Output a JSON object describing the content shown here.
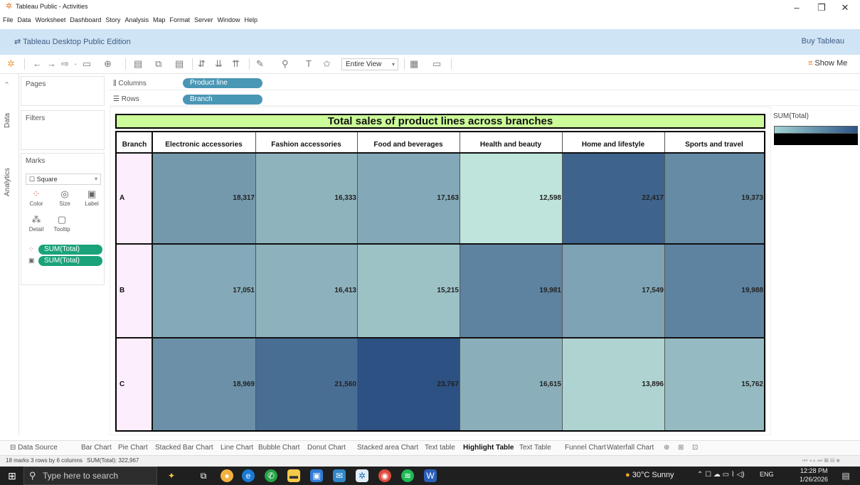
{
  "window": {
    "title": "Tableau Public - Activities"
  },
  "menu": [
    "File",
    "Data",
    "Worksheet",
    "Dashboard",
    "Story",
    "Analysis",
    "Map",
    "Format",
    "Server",
    "Window",
    "Help"
  ],
  "edition": {
    "label": "Tableau Desktop Public Edition",
    "buy": "Buy Tableau"
  },
  "toolbar": {
    "fit": "Entire View",
    "show_me": "Show Me"
  },
  "sidetabs": {
    "data": "Data",
    "analytics": "Analytics"
  },
  "panes": {
    "pages": "Pages",
    "filters": "Filters",
    "marks": "Marks",
    "mark_type": "Square",
    "buttons": {
      "color": "Color",
      "size": "Size",
      "label": "Label",
      "detail": "Detail",
      "tooltip": "Tooltip"
    },
    "pills": [
      "SUM(Total)",
      "SUM(Total)"
    ]
  },
  "shelves": {
    "columns": {
      "label": "Columns",
      "pill": "Product line"
    },
    "rows": {
      "label": "Rows",
      "pill": "Branch"
    }
  },
  "legend": {
    "title": "SUM(Total)",
    "colors": [
      "#9fd3d3",
      "#2d5486"
    ]
  },
  "chart_data": {
    "type": "heatmap",
    "title": "Total sales of product lines across branches",
    "row_header": "Branch",
    "columns": [
      "Electronic accessories",
      "Fashion accessories",
      "Food and beverages",
      "Health and beauty",
      "Home and lifestyle",
      "Sports and travel"
    ],
    "rows": [
      "A",
      "B",
      "C"
    ],
    "values": [
      [
        18317,
        16333,
        17163,
        12598,
        22417,
        19373
      ],
      [
        17051,
        16413,
        15215,
        19981,
        17549,
        19988
      ],
      [
        18969,
        21560,
        23767,
        16615,
        13896,
        15762
      ]
    ],
    "labels": [
      [
        "18,317",
        "16,333",
        "17,163",
        "12,598",
        "22,417",
        "19,373"
      ],
      [
        "17,051",
        "16,413",
        "15,215",
        "19,981",
        "17,549",
        "19,988"
      ],
      [
        "18,969",
        "21,560",
        "23,767",
        "16,615",
        "13,896",
        "15,762"
      ]
    ],
    "color_range": [
      "#bfe4db",
      "#2c5182"
    ]
  },
  "sheet_tabs": {
    "data_source": "Data Source",
    "tabs": [
      "Bar Chart",
      "Pie Chart",
      "Stacked Bar Chart",
      "Line Chart",
      "Bubble Chart",
      "Donut Chart",
      "Stacked area Chart",
      "Text table",
      "Highlight Table",
      "Text Table",
      "Funnel Chart",
      "Waterfall Chart"
    ],
    "active": "Highlight Table"
  },
  "status": {
    "marks": "18 marks",
    "dims": "3 rows by 6 columns",
    "sum": "SUM(Total): 322,967"
  },
  "taskbar": {
    "search_placeholder": "Type here to search",
    "weather": "30°C Sunny",
    "lang": "ENG",
    "time": "12:28 PM",
    "date": "1/26/2026"
  }
}
